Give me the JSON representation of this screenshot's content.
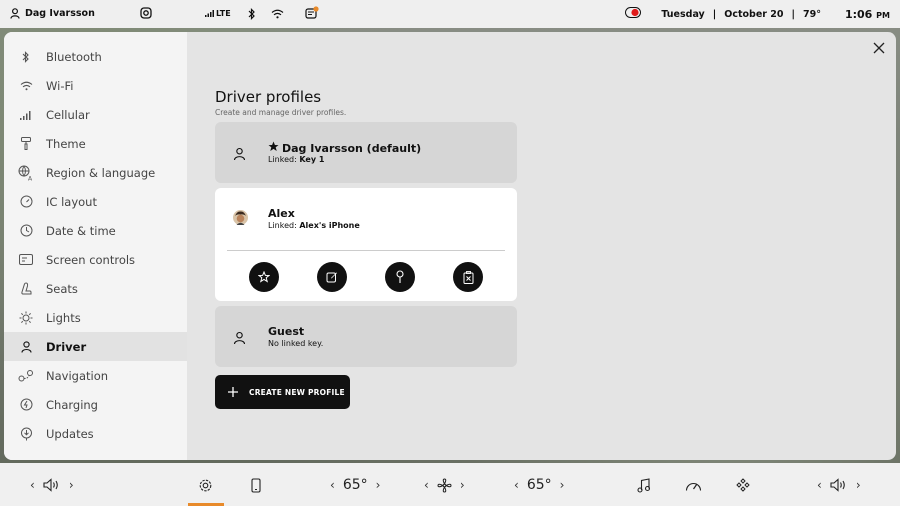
{
  "status": {
    "user": "Dag Ivarsson",
    "network": "LTE",
    "day": "Tuesday",
    "date": "October 20",
    "temp": "79°",
    "time": "1:06",
    "ampm": "PM"
  },
  "sidebar": {
    "items": [
      {
        "label": "Bluetooth",
        "icon": "bluetooth-icon"
      },
      {
        "label": "Wi-Fi",
        "icon": "wifi-icon"
      },
      {
        "label": "Cellular",
        "icon": "cellular-icon"
      },
      {
        "label": "Theme",
        "icon": "paint-roller-icon"
      },
      {
        "label": "Region & language",
        "icon": "language-icon"
      },
      {
        "label": "IC layout",
        "icon": "gauge-icon"
      },
      {
        "label": "Date & time",
        "icon": "clock-icon"
      },
      {
        "label": "Screen controls",
        "icon": "screen-icon"
      },
      {
        "label": "Seats",
        "icon": "seat-icon"
      },
      {
        "label": "Lights",
        "icon": "sun-icon"
      },
      {
        "label": "Driver",
        "icon": "person-icon"
      },
      {
        "label": "Navigation",
        "icon": "navigation-icon"
      },
      {
        "label": "Charging",
        "icon": "charging-icon"
      },
      {
        "label": "Updates",
        "icon": "updates-icon"
      }
    ],
    "active_index": 10
  },
  "main": {
    "title": "Driver profiles",
    "subtitle": "Create and manage driver profiles.",
    "profiles": [
      {
        "name": "Dag Ivarsson (default)",
        "linked_prefix": "Linked:",
        "linked_value": "Key 1"
      },
      {
        "name": "Alex",
        "linked_prefix": "Linked:",
        "linked_value": "Alex's iPhone"
      },
      {
        "name": "Guest",
        "linked_text": "No linked key."
      }
    ],
    "create_label": "CREATE NEW PROFILE"
  },
  "bottom": {
    "left_temp": "65°",
    "right_temp": "65°"
  },
  "colors": {
    "accent": "#e88a2a",
    "record": "#e01b1b"
  }
}
